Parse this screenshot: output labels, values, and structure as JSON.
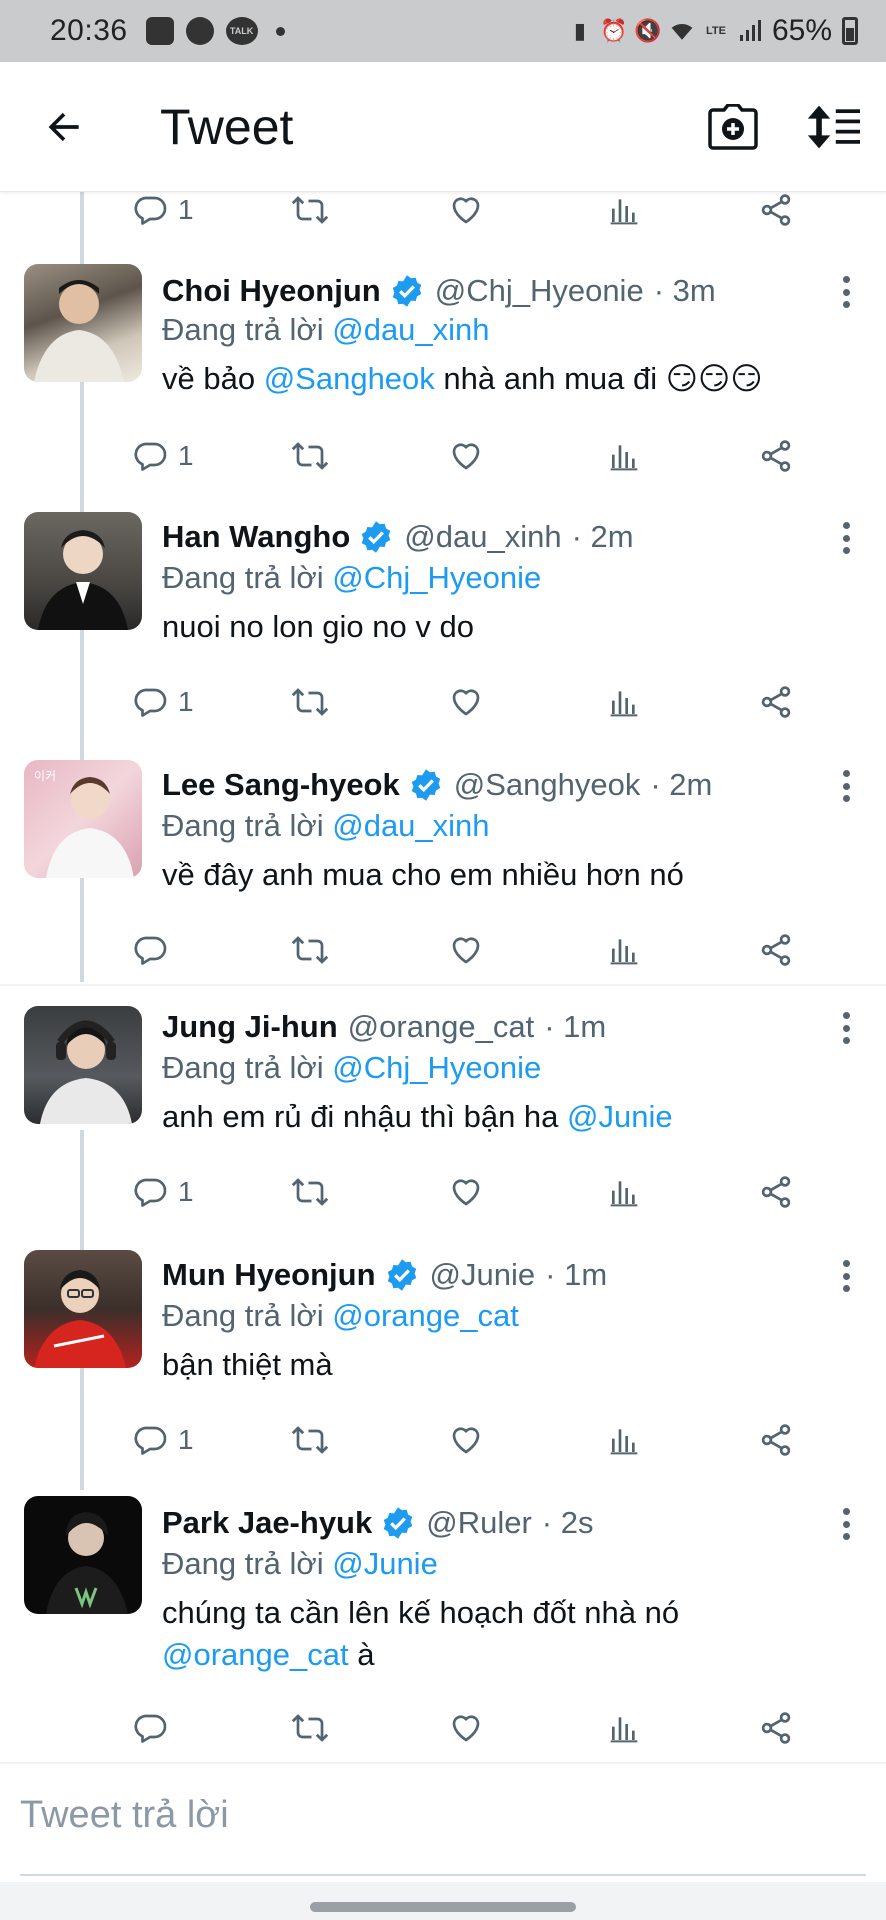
{
  "status_bar": {
    "time": "20:36",
    "talk_label": "TALK",
    "battery": "65%",
    "icons": [
      "gallery-icon",
      "messenger-icon",
      "kakaotalk-icon",
      "dot-icon",
      "battery-saver-icon",
      "alarm-icon",
      "mute-icon",
      "wifi-icon",
      "volte-icon",
      "signal-icon",
      "battery-icon"
    ]
  },
  "header": {
    "title": "Tweet",
    "back_icon": "back-arrow-icon",
    "camera_icon": "camera-plus-icon",
    "sort_icon": "sort-icon"
  },
  "top_actions": {
    "reply_count": "1"
  },
  "tweets": [
    {
      "name": "Choi Hyeonjun",
      "verified": true,
      "handle": "@Chj_Hyeonie",
      "time": "· 3m",
      "replying_prefix": "Đang trả lời ",
      "replying_to": "@dau_xinh",
      "text_before": "về bảo ",
      "text_mention": "@Sangheok",
      "text_after": " nhà anh mua đi 😏😏😏",
      "reply_count": "1"
    },
    {
      "name": "Han Wangho",
      "verified": true,
      "handle": "@dau_xinh",
      "time": "· 2m",
      "replying_prefix": "Đang trả lời ",
      "replying_to": "@Chj_Hyeonie",
      "text": "nuoi no lon gio no v do",
      "reply_count": "1"
    },
    {
      "name": "Lee Sang-hyeok",
      "verified": true,
      "handle": "@Sanghyeok",
      "time": "· 2m",
      "replying_prefix": "Đang trả lời ",
      "replying_to": "@dau_xinh",
      "text": "về đây anh mua cho em nhiều hơn nó",
      "reply_count": ""
    },
    {
      "name": "Jung Ji-hun",
      "verified": false,
      "handle": "@orange_cat",
      "time": "· 1m",
      "replying_prefix": "Đang trả lời ",
      "replying_to": "@Chj_Hyeonie",
      "text_before": "anh em rủ đi nhậu thì bận ha ",
      "text_mention": "@Junie",
      "reply_count": "1"
    },
    {
      "name": "Mun Hyeonjun",
      "verified": true,
      "handle": "@Junie",
      "time": "· 1m",
      "replying_prefix": "Đang trả lời ",
      "replying_to": "@orange_cat",
      "text": "bận thiệt mà",
      "reply_count": "1"
    },
    {
      "name": "Park Jae-hyuk",
      "verified": true,
      "handle": "@Ruler",
      "time": "· 2s",
      "replying_prefix": "Đang trả lời ",
      "replying_to": "@Junie",
      "text_line1": "chúng ta cần lên kế hoạch đốt nhà nó",
      "text_mention": "@orange_cat",
      "text_after": " à",
      "reply_count": ""
    }
  ],
  "reply_bar": {
    "placeholder": "Tweet trả lời"
  },
  "colors": {
    "accent": "#1d9bf0",
    "secondary_text": "#536471",
    "status_bar_bg": "#c9cbcd"
  }
}
